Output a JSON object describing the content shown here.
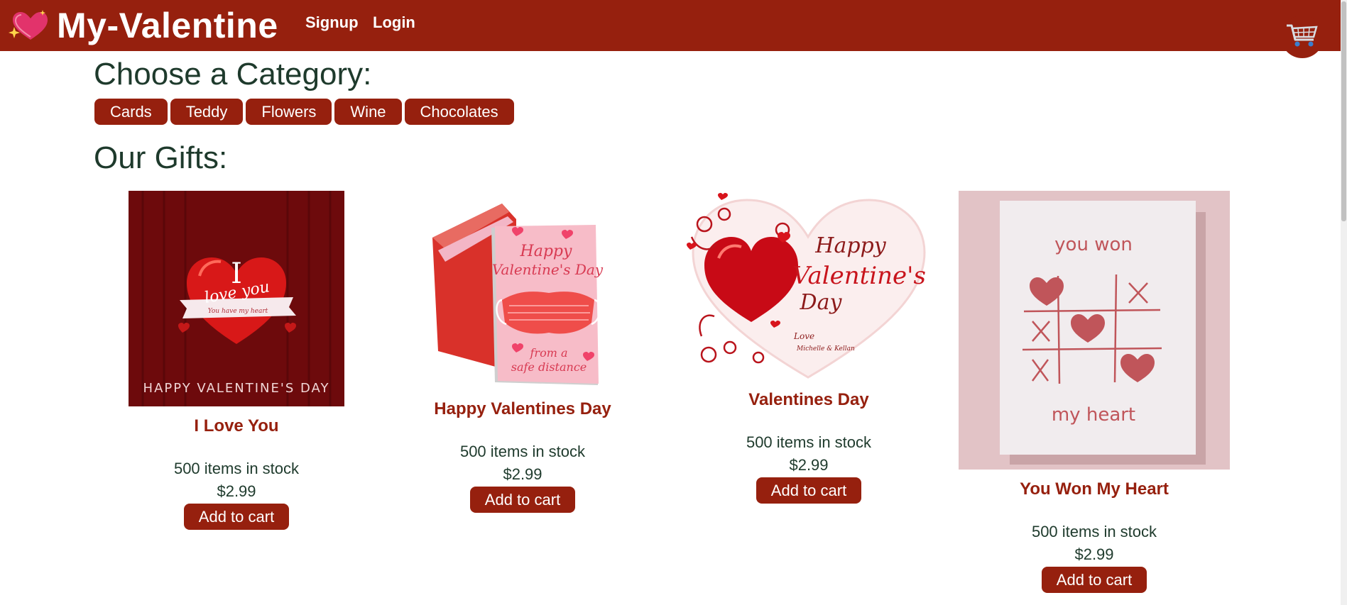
{
  "header": {
    "brand": "My-Valentine",
    "nav": [
      "Signup",
      "Login"
    ]
  },
  "main": {
    "category_heading": "Choose a Category:",
    "categories": [
      "Cards",
      "Teddy",
      "Flowers",
      "Wine",
      "Chocolates"
    ],
    "gifts_heading": "Our Gifts:",
    "products": [
      {
        "title": "I Love You",
        "stock": "500 items in stock",
        "price": "$2.99",
        "button": "Add to cart",
        "image_text": {
          "big_letter": "I",
          "love": "love you",
          "ribbon": "You have my heart",
          "footer": "HAPPY VALENTINE'S DAY"
        }
      },
      {
        "title": "Happy Valentines Day",
        "stock": "500 items in stock",
        "price": "$2.99",
        "button": "Add to cart",
        "image_text": {
          "line1": "Happy",
          "line2": "Valentine's Day",
          "line3": "from a",
          "line4": "safe distance"
        }
      },
      {
        "title": "Valentines Day",
        "stock": "500 items in stock",
        "price": "$2.99",
        "button": "Add to cart",
        "image_text": {
          "line1": "Happy",
          "line2": "Valentine's",
          "line3": "Day",
          "line4": "Love",
          "line5": "Michelle & Kellan"
        }
      },
      {
        "title": "You Won My Heart",
        "stock": "500 items in stock",
        "price": "$2.99",
        "button": "Add to cart",
        "image_text": {
          "top": "you won",
          "bottom": "my heart"
        }
      }
    ]
  },
  "colors": {
    "brand": "#96200e",
    "heading": "#1e3a2c",
    "background": "#ffffff"
  },
  "icons": {
    "logo": "sparkling-heart-icon",
    "cart": "shopping-cart-icon"
  }
}
